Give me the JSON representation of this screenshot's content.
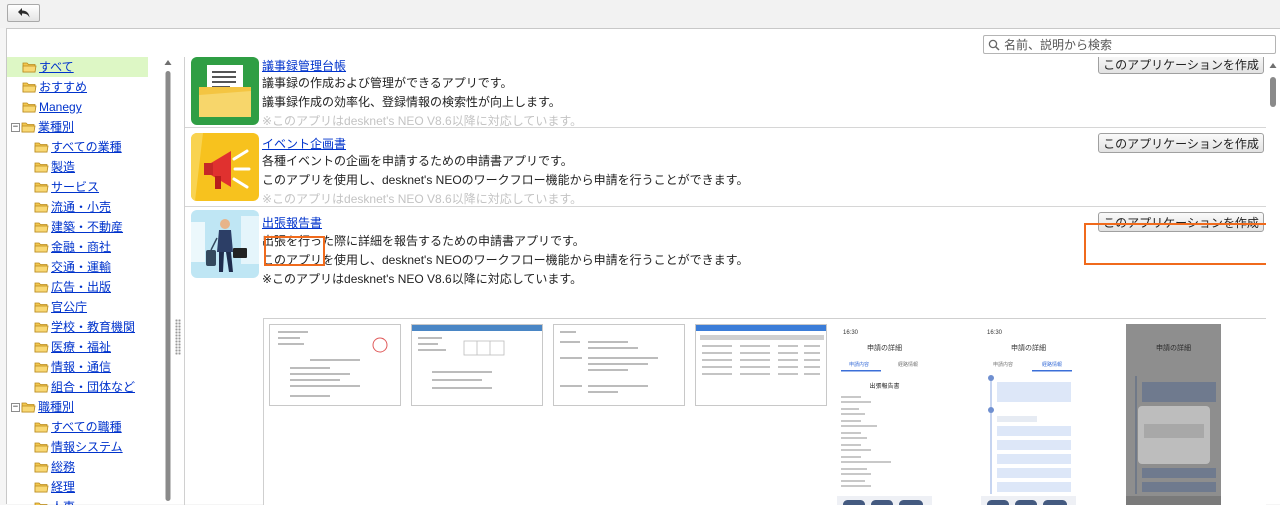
{
  "toolbar": {
    "back_icon": "back-arrow-icon"
  },
  "search": {
    "placeholder": "名前、説明から検索"
  },
  "tree": {
    "items": [
      {
        "label": "すべて",
        "level": 0,
        "toggle": "",
        "selected": true
      },
      {
        "label": "おすすめ",
        "level": 0,
        "toggle": "",
        "selected": false
      },
      {
        "label": "Manegy",
        "level": 0,
        "toggle": "",
        "selected": false
      },
      {
        "label": "業種別",
        "level": 0,
        "toggle": "−",
        "selected": false
      },
      {
        "label": "すべての業種",
        "level": 1,
        "toggle": "",
        "selected": false
      },
      {
        "label": "製造",
        "level": 1,
        "toggle": "",
        "selected": false
      },
      {
        "label": "サービス",
        "level": 1,
        "toggle": "",
        "selected": false
      },
      {
        "label": "流通・小売",
        "level": 1,
        "toggle": "",
        "selected": false
      },
      {
        "label": "建築・不動産",
        "level": 1,
        "toggle": "",
        "selected": false
      },
      {
        "label": "金融・商社",
        "level": 1,
        "toggle": "",
        "selected": false
      },
      {
        "label": "交通・運輸",
        "level": 1,
        "toggle": "",
        "selected": false
      },
      {
        "label": "広告・出版",
        "level": 1,
        "toggle": "",
        "selected": false
      },
      {
        "label": "官公庁",
        "level": 1,
        "toggle": "",
        "selected": false
      },
      {
        "label": "学校・教育機関",
        "level": 1,
        "toggle": "",
        "selected": false
      },
      {
        "label": "医療・福祉",
        "level": 1,
        "toggle": "",
        "selected": false
      },
      {
        "label": "情報・通信",
        "level": 1,
        "toggle": "",
        "selected": false
      },
      {
        "label": "組合・団体など",
        "level": 1,
        "toggle": "",
        "selected": false
      },
      {
        "label": "職種別",
        "level": 0,
        "toggle": "−",
        "selected": false
      },
      {
        "label": "すべての職種",
        "level": 1,
        "toggle": "",
        "selected": false
      },
      {
        "label": "情報システム",
        "level": 1,
        "toggle": "",
        "selected": false
      },
      {
        "label": "総務",
        "level": 1,
        "toggle": "",
        "selected": false
      },
      {
        "label": "経理",
        "level": 1,
        "toggle": "",
        "selected": false
      },
      {
        "label": "人事",
        "level": 1,
        "toggle": "",
        "selected": false
      }
    ]
  },
  "apps": [
    {
      "title": "議事録管理台帳",
      "lines": [
        "議事録の作成および管理ができるアプリです。",
        "議事録作成の効率化、登録情報の検索性が向上します。"
      ],
      "faded_line": "※このアプリはdesknet's NEO V8.6以降に対応しています。",
      "button_label": "このアプリケーションを作成",
      "icon": "minutes-folder-icon"
    },
    {
      "title": "イベント企画書",
      "lines": [
        "各種イベントの企画を申請するための申請書アプリです。",
        "このアプリを使用し、desknet's NEOのワークフロー機能から申請を行うことができます。"
      ],
      "faded_line": "※このアプリはdesknet's NEO V8.6以降に対応しています。",
      "button_label": "このアプリケーションを作成",
      "icon": "megaphone-icon"
    },
    {
      "title": "出張報告書",
      "lines": [
        "出張を行った際に詳細を報告するための申請書アプリです。",
        "このアプリを使用し、desknet's NEOのワークフロー機能から申請を行うことができます。",
        "※このアプリはdesknet's NEO V8.6以降に対応しています。"
      ],
      "faded_line": "",
      "button_label": "このアプリケーションを作成",
      "icon": "business-traveler-icon"
    }
  ],
  "screenshots": {
    "mobile_header": "申請の詳細",
    "mobile_tab1": "申請内容",
    "mobile_tab2": "経路情報",
    "mobile_doc_title": "出張報告書",
    "mobile_time": "16:30"
  },
  "colors": {
    "highlight": "#f06a1c",
    "selected_bg": "#ddf7c5",
    "link": "#0033cc"
  }
}
